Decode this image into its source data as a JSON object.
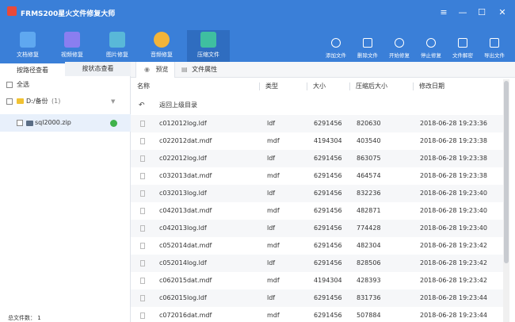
{
  "app": {
    "title": "FRMS200星火文件修复大师"
  },
  "window": {
    "menu_icon": "≡",
    "minimize_icon": "—",
    "maximize_icon": "☐",
    "close_icon": "✕"
  },
  "toolbar": {
    "tools": [
      {
        "label": "文档修复",
        "icon": "document-icon",
        "color": "#5fa8f0"
      },
      {
        "label": "视频修复",
        "icon": "video-icon",
        "color": "#8a7ef0"
      },
      {
        "label": "图片修复",
        "icon": "image-icon",
        "color": "#59b8d8"
      },
      {
        "label": "音频修复",
        "icon": "audio-icon",
        "color": "#f2b43a"
      },
      {
        "label": "压缩文件",
        "icon": "archive-icon",
        "color": "#3fbfa0"
      }
    ],
    "actions": [
      {
        "label": "添加文件",
        "icon": "add-icon"
      },
      {
        "label": "删除文件",
        "icon": "trash-icon"
      },
      {
        "label": "开始修复",
        "icon": "play-icon"
      },
      {
        "label": "停止修复",
        "icon": "stop-icon"
      },
      {
        "label": "文件解密",
        "icon": "unlock-icon"
      },
      {
        "label": "导出文件",
        "icon": "export-icon"
      }
    ]
  },
  "sidebar": {
    "tabs": [
      "按路径查看",
      "按状态查看"
    ],
    "select_all": "全选",
    "folder": {
      "label": "D:/备份",
      "count": "(1)"
    },
    "file": {
      "label": "sql2000.zip"
    },
    "footer": "总文件数： 1"
  },
  "main": {
    "tabs": [
      "预览",
      "文件属性"
    ],
    "columns": [
      "名称",
      "类型",
      "大小",
      "压缩后大小",
      "修改日期"
    ],
    "back_label": "返回上级目录",
    "rows": [
      [
        "c012012log.ldf",
        "ldf",
        "6291456",
        "820630",
        "2018-06-28 19:23:36"
      ],
      [
        "c022012dat.mdf",
        "mdf",
        "4194304",
        "403540",
        "2018-06-28 19:23:38"
      ],
      [
        "c022012log.ldf",
        "ldf",
        "6291456",
        "863075",
        "2018-06-28 19:23:38"
      ],
      [
        "c032013dat.mdf",
        "mdf",
        "6291456",
        "464574",
        "2018-06-28 19:23:38"
      ],
      [
        "c032013log.ldf",
        "ldf",
        "6291456",
        "832236",
        "2018-06-28 19:23:40"
      ],
      [
        "c042013dat.mdf",
        "mdf",
        "6291456",
        "482871",
        "2018-06-28 19:23:40"
      ],
      [
        "c042013log.ldf",
        "ldf",
        "6291456",
        "774428",
        "2018-06-28 19:23:40"
      ],
      [
        "c052014dat.mdf",
        "mdf",
        "6291456",
        "482304",
        "2018-06-28 19:23:42"
      ],
      [
        "c052014log.ldf",
        "ldf",
        "6291456",
        "828506",
        "2018-06-28 19:23:42"
      ],
      [
        "c062015dat.mdf",
        "mdf",
        "4194304",
        "428393",
        "2018-06-28 19:23:42"
      ],
      [
        "c062015log.ldf",
        "ldf",
        "6291456",
        "831736",
        "2018-06-28 19:23:44"
      ],
      [
        "c072016dat.mdf",
        "mdf",
        "6291456",
        "507884",
        "2018-06-28 19:23:44"
      ]
    ]
  }
}
